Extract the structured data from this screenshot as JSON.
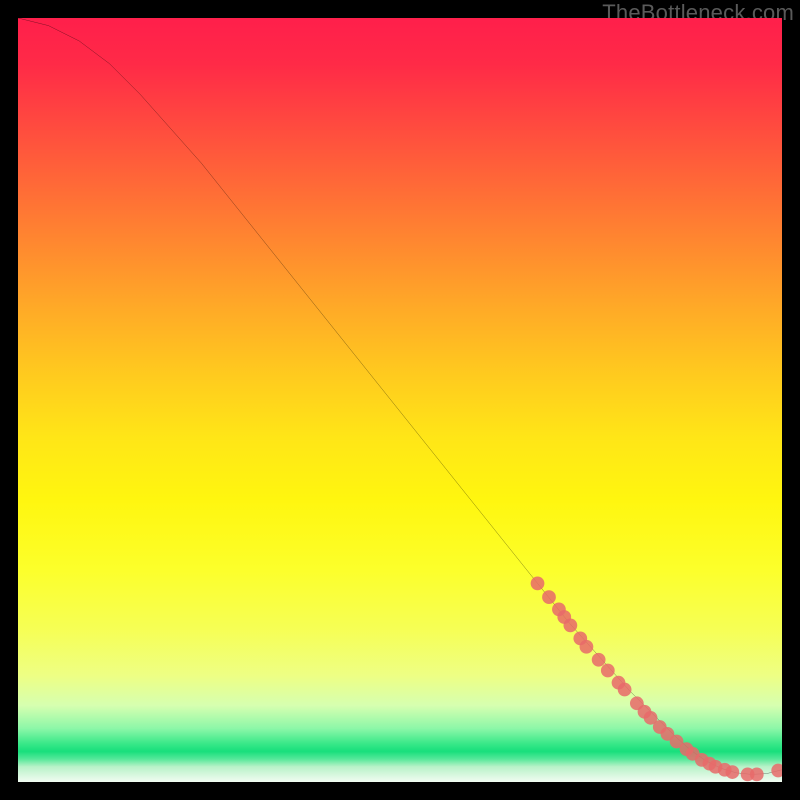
{
  "watermark": "TheBottleneck.com",
  "chart_data": {
    "type": "line",
    "title": "",
    "xlabel": "",
    "ylabel": "",
    "xlim": [
      0,
      100
    ],
    "ylim": [
      0,
      100
    ],
    "grid": false,
    "legend": false,
    "series": [
      {
        "name": "curve",
        "color": "#000000",
        "x": [
          0,
          4,
          8,
          12,
          16,
          20,
          24,
          28,
          32,
          36,
          40,
          44,
          48,
          52,
          56,
          60,
          64,
          68,
          72,
          76,
          80,
          84,
          86,
          88,
          90,
          92,
          94,
          96,
          98,
          100
        ],
        "y": [
          100,
          99,
          97,
          94,
          90,
          85.5,
          81,
          76,
          71,
          66,
          61,
          56,
          51,
          46,
          41,
          36,
          31,
          26,
          21,
          16.5,
          12,
          8,
          6,
          4.2,
          2.8,
          1.8,
          1.2,
          1.0,
          1.1,
          1.6
        ]
      }
    ],
    "highlight_points": {
      "name": "highlight",
      "color": "#e86a6a",
      "radius_frac": 0.009,
      "points": [
        {
          "x": 68.0,
          "y": 26.0
        },
        {
          "x": 69.5,
          "y": 24.2
        },
        {
          "x": 70.8,
          "y": 22.6
        },
        {
          "x": 71.5,
          "y": 21.6
        },
        {
          "x": 72.3,
          "y": 20.5
        },
        {
          "x": 73.6,
          "y": 18.8
        },
        {
          "x": 74.4,
          "y": 17.7
        },
        {
          "x": 76.0,
          "y": 16.0
        },
        {
          "x": 77.2,
          "y": 14.6
        },
        {
          "x": 78.6,
          "y": 13.0
        },
        {
          "x": 79.4,
          "y": 12.1
        },
        {
          "x": 81.0,
          "y": 10.3
        },
        {
          "x": 82.0,
          "y": 9.2
        },
        {
          "x": 82.8,
          "y": 8.4
        },
        {
          "x": 84.0,
          "y": 7.2
        },
        {
          "x": 85.0,
          "y": 6.3
        },
        {
          "x": 86.2,
          "y": 5.3
        },
        {
          "x": 87.5,
          "y": 4.3
        },
        {
          "x": 88.3,
          "y": 3.7
        },
        {
          "x": 89.5,
          "y": 2.9
        },
        {
          "x": 90.5,
          "y": 2.4
        },
        {
          "x": 91.3,
          "y": 2.0
        },
        {
          "x": 92.5,
          "y": 1.6
        },
        {
          "x": 93.5,
          "y": 1.3
        },
        {
          "x": 95.5,
          "y": 1.0
        },
        {
          "x": 96.7,
          "y": 1.0
        },
        {
          "x": 99.5,
          "y": 1.5
        }
      ]
    }
  }
}
